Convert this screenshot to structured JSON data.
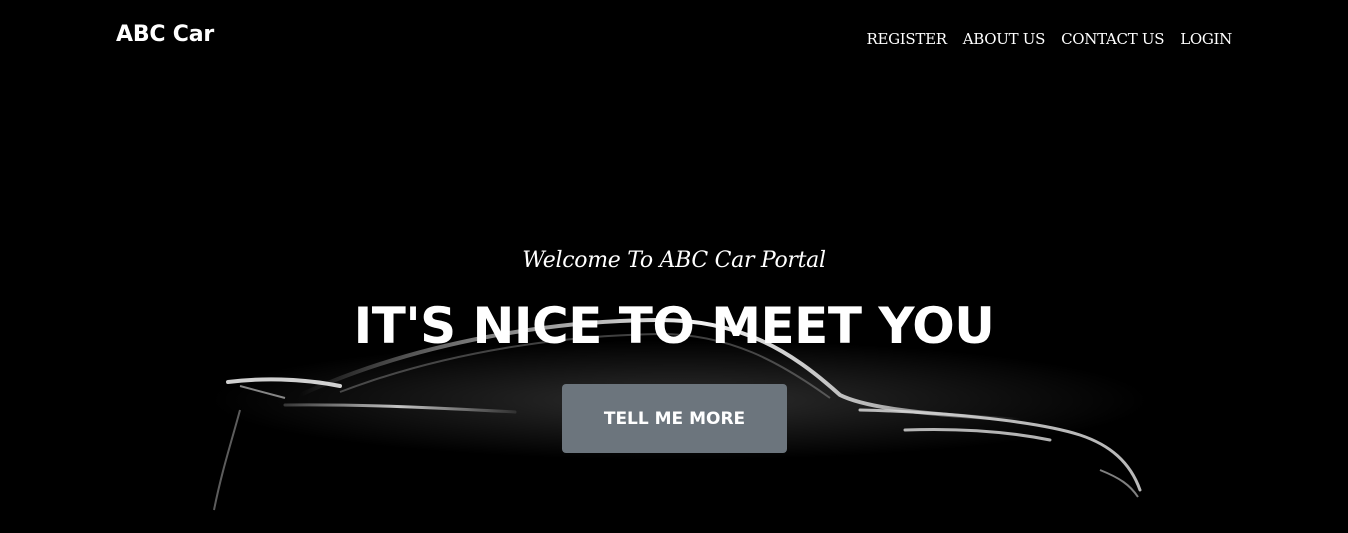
{
  "navbar": {
    "brand": "ABC Car",
    "links": [
      {
        "label": "REGISTER"
      },
      {
        "label": "ABOUT US"
      },
      {
        "label": "CONTACT US"
      },
      {
        "label": "LOGIN"
      }
    ]
  },
  "hero": {
    "subheading": "Welcome To ABC Car Portal",
    "heading": "IT'S NICE TO MEET YOU",
    "cta_label": "TELL ME MORE",
    "cta_color": "#6c757d"
  },
  "background": {
    "color": "#000000",
    "image": "car-silhouette"
  }
}
